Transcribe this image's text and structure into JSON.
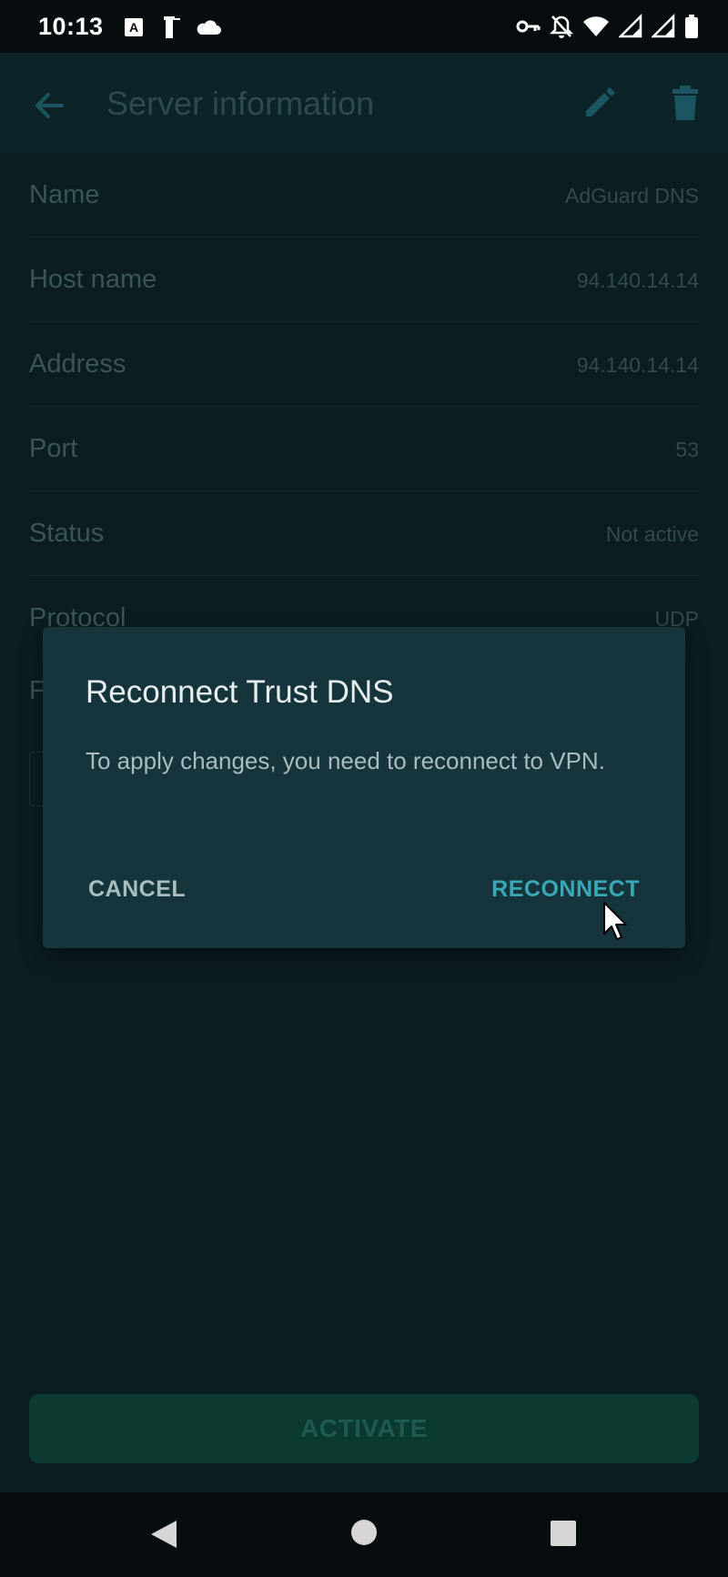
{
  "status_bar": {
    "time": "10:13",
    "left_icons": [
      "a-box-icon",
      "lighthouse-icon",
      "cloud-icon"
    ],
    "right_icons": [
      "vpn-key-icon",
      "bell-off-icon",
      "wifi-icon",
      "signal-icon",
      "signal-icon",
      "battery-icon"
    ]
  },
  "appbar": {
    "title": "Server information",
    "accent_color": "#1b5560"
  },
  "server_info": {
    "rows": [
      {
        "label": "Name",
        "value": "AdGuard DNS"
      },
      {
        "label": "Host name",
        "value": "94.140.14.14"
      },
      {
        "label": "Address",
        "value": "94.140.14.14"
      },
      {
        "label": "Port",
        "value": "53"
      },
      {
        "label": "Status",
        "value": "Not active"
      },
      {
        "label": "Protocol",
        "value": "UDP"
      }
    ],
    "partial_label": "F"
  },
  "dialog": {
    "title": "Reconnect Trust DNS",
    "message": "To apply changes, you need to reconnect to VPN.",
    "cancel_label": "CANCEL",
    "confirm_label": "RECONNECT",
    "confirm_color": "#3ba8b8"
  },
  "bottom": {
    "activate_label": "ACTIVATE"
  }
}
